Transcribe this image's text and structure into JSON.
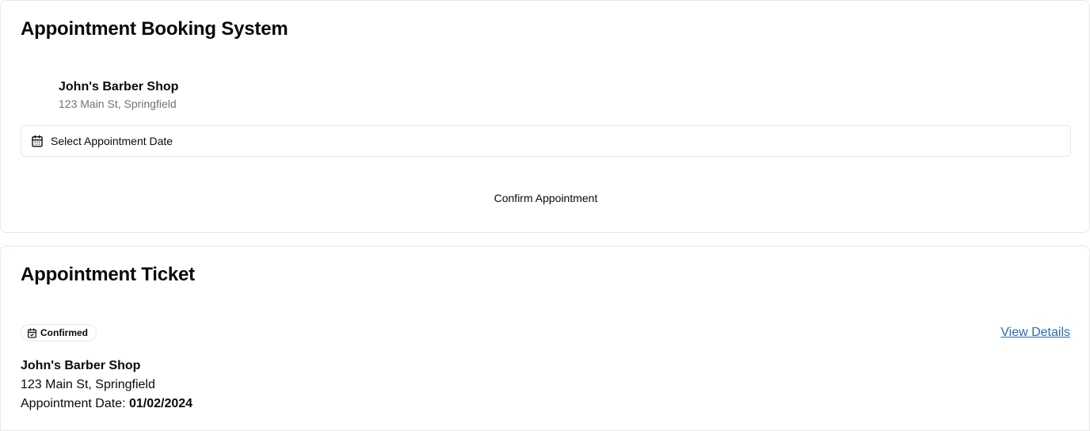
{
  "booking": {
    "title": "Appointment Booking System",
    "shop_name": "John's Barber Shop",
    "shop_address": "123 Main St, Springfield",
    "date_picker_label": "Select Appointment Date",
    "confirm_label": "Confirm Appointment"
  },
  "ticket": {
    "title": "Appointment Ticket",
    "status": "Confirmed",
    "view_details_label": "View Details",
    "shop_name": "John's Barber Shop",
    "shop_address": "123 Main St, Springfield",
    "date_label": "Appointment Date:",
    "date_value": "01/02/2024"
  },
  "icons": {
    "date_picker_icon": "calendar-icon",
    "status_icon": "calendar-check-icon"
  },
  "colors": {
    "link": "#2b6cb0",
    "muted_text": "#71717a",
    "border": "#e5e7eb"
  }
}
